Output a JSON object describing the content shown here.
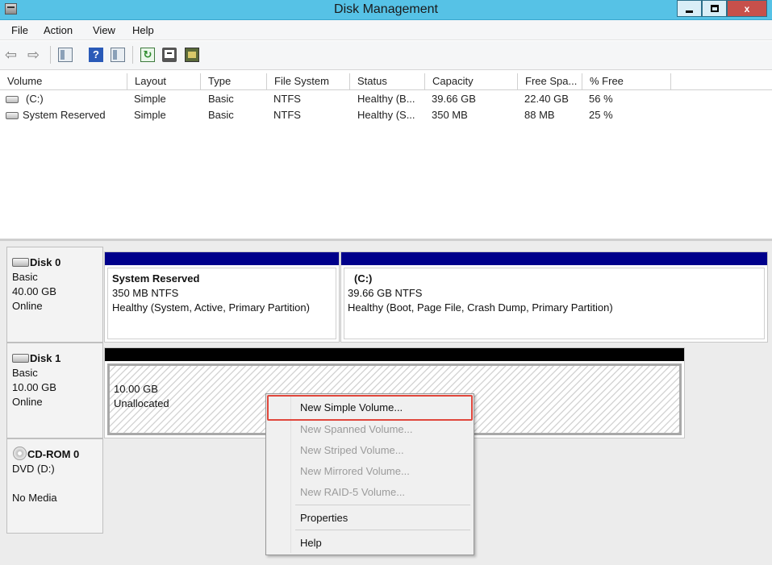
{
  "window": {
    "title": "Disk Management",
    "controls": {
      "minimize": "",
      "maximize": "",
      "close": "x"
    }
  },
  "menu": {
    "file": "File",
    "action": "Action",
    "view": "View",
    "help": "Help"
  },
  "toolbar": {
    "icons": [
      "back-arrow-icon",
      "forward-arrow-icon",
      "show-hide-console-tree-icon",
      "help-icon",
      "console-panel-icon",
      "refresh-icon",
      "properties-icon",
      "disk-management-icon"
    ],
    "back_glyph": "⇦",
    "forward_glyph": "⇨",
    "help_glyph": "?",
    "refresh_glyph": "↻"
  },
  "volume_list": {
    "columns": [
      "Volume",
      "Layout",
      "Type",
      "File System",
      "Status",
      "Capacity",
      "Free Spa...",
      "% Free"
    ],
    "rows": [
      {
        "volume": "(C:)",
        "layout": "Simple",
        "type": "Basic",
        "fs": "NTFS",
        "status": "Healthy (B...",
        "capacity": "39.66 GB",
        "free": "22.40 GB",
        "pct": "56 %"
      },
      {
        "volume": "System Reserved",
        "layout": "Simple",
        "type": "Basic",
        "fs": "NTFS",
        "status": "Healthy (S...",
        "capacity": "350 MB",
        "free": "88 MB",
        "pct": "25 %"
      }
    ]
  },
  "disks": {
    "disk0": {
      "name": "Disk 0",
      "kind": "Basic",
      "size": "40.00 GB",
      "state": "Online",
      "partitions": [
        {
          "name": "System Reserved",
          "size": "350 MB NTFS",
          "status": "Healthy (System, Active, Primary Partition)"
        },
        {
          "name": "(C:)",
          "size": "39.66 GB NTFS",
          "status": "Healthy (Boot, Page File, Crash Dump, Primary Partition)"
        }
      ]
    },
    "disk1": {
      "name": "Disk 1",
      "kind": "Basic",
      "size": "10.00 GB",
      "state": "Online",
      "partition": {
        "size": "10.00 GB",
        "status": "Unallocated"
      }
    },
    "cdrom0": {
      "name": "CD-ROM 0",
      "kind": "DVD (D:)",
      "state": "No Media"
    }
  },
  "context_menu": {
    "items": [
      {
        "label": "New Simple Volume...",
        "enabled": true
      },
      {
        "label": "New Spanned Volume...",
        "enabled": false
      },
      {
        "label": "New Striped Volume...",
        "enabled": false
      },
      {
        "label": "New Mirrored Volume...",
        "enabled": false
      },
      {
        "label": "New RAID-5 Volume...",
        "enabled": false
      },
      {
        "label": "Properties",
        "enabled": true
      },
      {
        "label": "Help",
        "enabled": true
      }
    ],
    "highlight_color": "#e0473c"
  },
  "colors": {
    "titlebar": "#56c2e6",
    "primary_partition_bar": "#00008b",
    "unallocated_bar": "#000000",
    "close_button": "#c7504b"
  }
}
